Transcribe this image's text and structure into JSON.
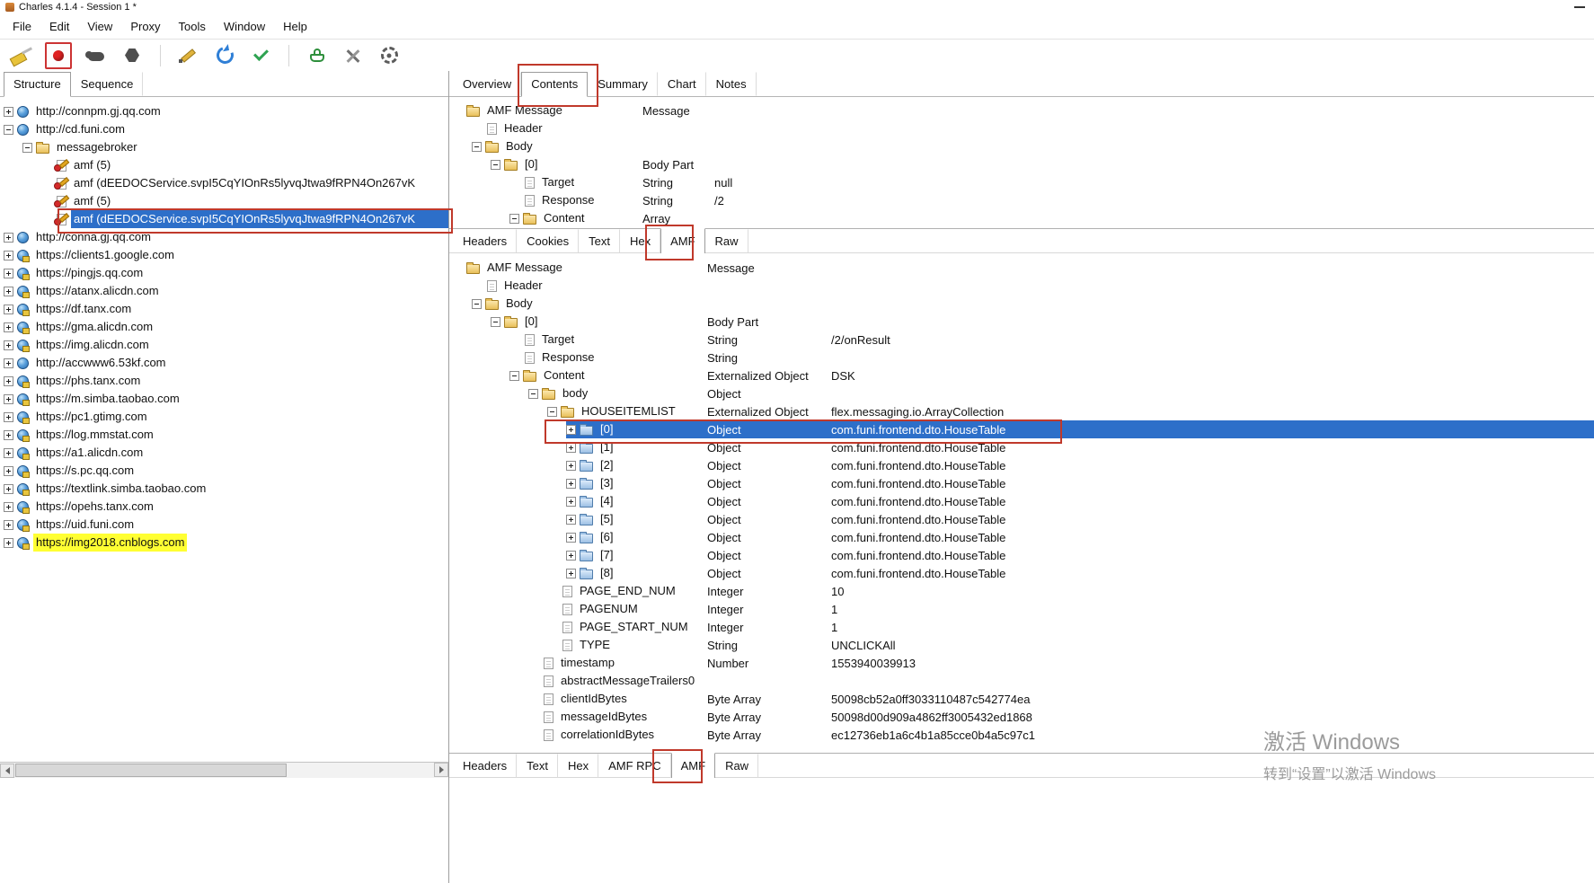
{
  "window": {
    "title": "Charles 4.1.4 - Session 1 *"
  },
  "menu": {
    "items": [
      "File",
      "Edit",
      "View",
      "Proxy",
      "Tools",
      "Window",
      "Help"
    ]
  },
  "toolbar": {
    "icons": [
      {
        "name": "clear-session-icon",
        "key": "clear"
      },
      {
        "name": "record-button",
        "key": "record"
      },
      {
        "name": "throttle-icon",
        "key": "throttle"
      },
      {
        "name": "breakpoints-icon",
        "key": "break"
      },
      {
        "name": "separator",
        "key": "sep"
      },
      {
        "name": "compose-icon",
        "key": "compose"
      },
      {
        "name": "repeat-icon",
        "key": "repeat"
      },
      {
        "name": "validate-icon",
        "key": "validate"
      },
      {
        "name": "separator",
        "key": "sep"
      },
      {
        "name": "tools-basket-icon",
        "key": "basket"
      },
      {
        "name": "tools-wrench-icon",
        "key": "wrench"
      },
      {
        "name": "settings-gear-icon",
        "key": "gear"
      }
    ]
  },
  "left_panel": {
    "tabs": [
      "Structure",
      "Sequence"
    ],
    "active_tab": "Structure",
    "tree": [
      {
        "label": "http://connpm.gj.qq.com",
        "level": 0,
        "icon": "globe",
        "expand": "plus"
      },
      {
        "label": "http://cd.funi.com",
        "level": 0,
        "icon": "globe",
        "expand": "minus"
      },
      {
        "label": "messagebroker",
        "level": 1,
        "icon": "folder",
        "expand": "minus"
      },
      {
        "label": "amf (5)",
        "level": 2,
        "icon": "amf",
        "expand": "none"
      },
      {
        "label": "amf (dEEDOCService.svpI5CqYIOnRs5lyvqJtwa9fRPN4On267vK",
        "level": 2,
        "icon": "amf",
        "expand": "none"
      },
      {
        "label": "amf (5)",
        "level": 2,
        "icon": "amf",
        "expand": "none"
      },
      {
        "label": "amf (dEEDOCService.svpI5CqYIOnRs5lyvqJtwa9fRPN4On267vK",
        "level": 2,
        "icon": "amf",
        "expand": "none",
        "selected": true
      },
      {
        "label": "http://conna.gj.qq.com",
        "level": 0,
        "icon": "globe",
        "expand": "plus"
      },
      {
        "label": "https://clients1.google.com",
        "level": 0,
        "icon": "globe-lock",
        "expand": "plus"
      },
      {
        "label": "https://pingjs.qq.com",
        "level": 0,
        "icon": "globe-lock",
        "expand": "plus"
      },
      {
        "label": "https://atanx.alicdn.com",
        "level": 0,
        "icon": "globe-lock",
        "expand": "plus"
      },
      {
        "label": "https://df.tanx.com",
        "level": 0,
        "icon": "globe-lock",
        "expand": "plus"
      },
      {
        "label": "https://gma.alicdn.com",
        "level": 0,
        "icon": "globe-lock",
        "expand": "plus"
      },
      {
        "label": "https://img.alicdn.com",
        "level": 0,
        "icon": "globe-lock",
        "expand": "plus"
      },
      {
        "label": "http://accwww6.53kf.com",
        "level": 0,
        "icon": "globe",
        "expand": "plus"
      },
      {
        "label": "https://phs.tanx.com",
        "level": 0,
        "icon": "globe-lock",
        "expand": "plus"
      },
      {
        "label": "https://m.simba.taobao.com",
        "level": 0,
        "icon": "globe-lock",
        "expand": "plus"
      },
      {
        "label": "https://pc1.gtimg.com",
        "level": 0,
        "icon": "globe-lock",
        "expand": "plus"
      },
      {
        "label": "https://log.mmstat.com",
        "level": 0,
        "icon": "globe-lock",
        "expand": "plus"
      },
      {
        "label": "https://a1.alicdn.com",
        "level": 0,
        "icon": "globe-lock",
        "expand": "plus"
      },
      {
        "label": "https://s.pc.qq.com",
        "level": 0,
        "icon": "globe-lock",
        "expand": "plus"
      },
      {
        "label": "https://textlink.simba.taobao.com",
        "level": 0,
        "icon": "globe-lock",
        "expand": "plus"
      },
      {
        "label": "https://opehs.tanx.com",
        "level": 0,
        "icon": "globe-lock",
        "expand": "plus"
      },
      {
        "label": "https://uid.funi.com",
        "level": 0,
        "icon": "globe-lock",
        "expand": "plus"
      },
      {
        "label": "https://img2018.cnblogs.com",
        "level": 0,
        "icon": "globe-lock",
        "expand": "plus",
        "highlight": true
      }
    ]
  },
  "right_panel": {
    "tabs": [
      "Overview",
      "Contents",
      "Summary",
      "Chart",
      "Notes"
    ],
    "active_tab": "Contents",
    "request_viewer": {
      "tabs": [
        "Headers",
        "Cookies",
        "Text",
        "Hex",
        "AMF",
        "Raw"
      ],
      "active_tab": "AMF",
      "tree": [
        {
          "label": "AMF Message",
          "level": 0,
          "icon": "folder",
          "expand": "none",
          "type": "Message",
          "value": ""
        },
        {
          "label": "Header",
          "level": 1,
          "icon": "file",
          "expand": "none",
          "type": "",
          "value": ""
        },
        {
          "label": "Body",
          "level": 1,
          "icon": "folder",
          "expand": "minus",
          "type": "",
          "value": ""
        },
        {
          "label": "[0]",
          "level": 2,
          "icon": "folder",
          "expand": "minus",
          "type": "Body Part",
          "value": ""
        },
        {
          "label": "Target",
          "level": 3,
          "icon": "file",
          "expand": "none",
          "type": "String",
          "value": "null"
        },
        {
          "label": "Response",
          "level": 3,
          "icon": "file",
          "expand": "none",
          "type": "String",
          "value": "/2"
        },
        {
          "label": "Content",
          "level": 3,
          "icon": "folder",
          "expand": "minus",
          "type": "Array",
          "value": ""
        }
      ]
    },
    "response_viewer": {
      "tabs": [
        "Headers",
        "Text",
        "Hex",
        "AMF RPC",
        "AMF",
        "Raw"
      ],
      "active_tab": "AMF",
      "tree": [
        {
          "label": "AMF Message",
          "level": 0,
          "icon": "folder",
          "expand": "none",
          "type": "Message",
          "value": ""
        },
        {
          "label": "Header",
          "level": 1,
          "icon": "file",
          "expand": "none",
          "type": "",
          "value": ""
        },
        {
          "label": "Body",
          "level": 1,
          "icon": "folder",
          "expand": "minus",
          "type": "",
          "value": ""
        },
        {
          "label": "[0]",
          "level": 2,
          "icon": "folder",
          "expand": "minus",
          "type": "Body Part",
          "value": ""
        },
        {
          "label": "Target",
          "level": 3,
          "icon": "file",
          "expand": "none",
          "type": "String",
          "value": "/2/onResult"
        },
        {
          "label": "Response",
          "level": 3,
          "icon": "file",
          "expand": "none",
          "type": "String",
          "value": ""
        },
        {
          "label": "Content",
          "level": 3,
          "icon": "folder",
          "expand": "minus",
          "type": "Externalized Object",
          "value": "DSK"
        },
        {
          "label": "body",
          "level": 4,
          "icon": "folder",
          "expand": "minus",
          "type": "Object",
          "value": ""
        },
        {
          "label": "HOUSEITEMLIST",
          "level": 5,
          "icon": "folder",
          "expand": "minus",
          "type": "Externalized Object",
          "value": "flex.messaging.io.ArrayCollection"
        },
        {
          "label": "[0]",
          "level": 6,
          "icon": "folder-blue",
          "expand": "plus",
          "type": "Object",
          "value": "com.funi.frontend.dto.HouseTable",
          "selected": true
        },
        {
          "label": "[1]",
          "level": 6,
          "icon": "folder-blue",
          "expand": "plus",
          "type": "Object",
          "value": "com.funi.frontend.dto.HouseTable"
        },
        {
          "label": "[2]",
          "level": 6,
          "icon": "folder-blue",
          "expand": "plus",
          "type": "Object",
          "value": "com.funi.frontend.dto.HouseTable"
        },
        {
          "label": "[3]",
          "level": 6,
          "icon": "folder-blue",
          "expand": "plus",
          "type": "Object",
          "value": "com.funi.frontend.dto.HouseTable"
        },
        {
          "label": "[4]",
          "level": 6,
          "icon": "folder-blue",
          "expand": "plus",
          "type": "Object",
          "value": "com.funi.frontend.dto.HouseTable"
        },
        {
          "label": "[5]",
          "level": 6,
          "icon": "folder-blue",
          "expand": "plus",
          "type": "Object",
          "value": "com.funi.frontend.dto.HouseTable"
        },
        {
          "label": "[6]",
          "level": 6,
          "icon": "folder-blue",
          "expand": "plus",
          "type": "Object",
          "value": "com.funi.frontend.dto.HouseTable"
        },
        {
          "label": "[7]",
          "level": 6,
          "icon": "folder-blue",
          "expand": "plus",
          "type": "Object",
          "value": "com.funi.frontend.dto.HouseTable"
        },
        {
          "label": "[8]",
          "level": 6,
          "icon": "folder-blue",
          "expand": "plus",
          "type": "Object",
          "value": "com.funi.frontend.dto.HouseTable"
        },
        {
          "label": "PAGE_END_NUM",
          "level": 5,
          "icon": "file",
          "expand": "none",
          "type": "Integer",
          "value": "10"
        },
        {
          "label": "PAGENUM",
          "level": 5,
          "icon": "file",
          "expand": "none",
          "type": "Integer",
          "value": "1"
        },
        {
          "label": "PAGE_START_NUM",
          "level": 5,
          "icon": "file",
          "expand": "none",
          "type": "Integer",
          "value": "1"
        },
        {
          "label": "TYPE",
          "level": 5,
          "icon": "file",
          "expand": "none",
          "type": "String",
          "value": "UNCLICKAll"
        },
        {
          "label": "timestamp",
          "level": 4,
          "icon": "file",
          "expand": "none",
          "type": "Number",
          "value": "1553940039913"
        },
        {
          "label": "abstractMessageTrailers0",
          "level": 4,
          "icon": "file",
          "expand": "none",
          "type": "",
          "value": ""
        },
        {
          "label": "clientIdBytes",
          "level": 4,
          "icon": "file",
          "expand": "none",
          "type": "Byte Array",
          "value": "50098cb52a0ff3033110487c542774ea"
        },
        {
          "label": "messageIdBytes",
          "level": 4,
          "icon": "file",
          "expand": "none",
          "type": "Byte Array",
          "value": "50098d00d909a4862ff3005432ed1868"
        },
        {
          "label": "correlationIdBytes",
          "level": 4,
          "icon": "file",
          "expand": "none",
          "type": "Byte Array",
          "value": "ec12736eb1a6c4b1a85cce0b4a5c97c1"
        }
      ]
    }
  },
  "watermark": {
    "line1": "激活 Windows",
    "line2": "转到“设置”以激活 Windows"
  }
}
